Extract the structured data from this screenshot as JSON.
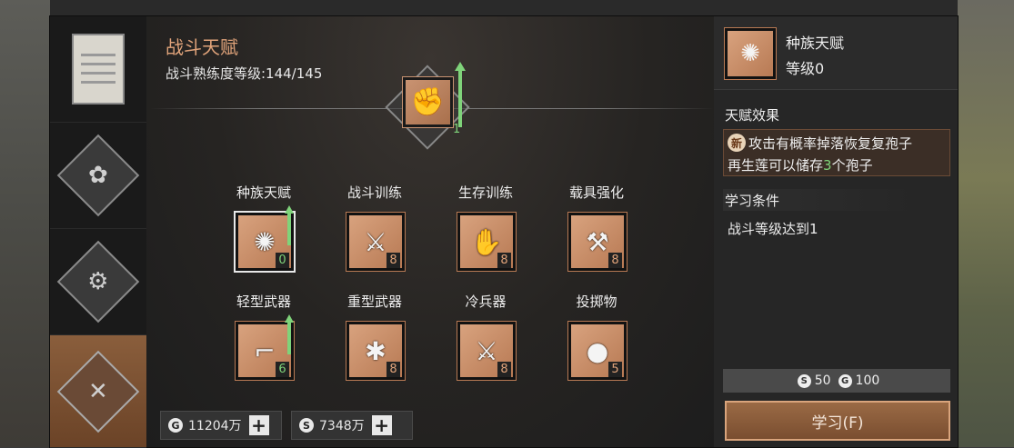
{
  "header": {
    "title": "战斗天赋",
    "proficiency": "战斗熟练度等级:144/145"
  },
  "hero": {
    "count": "1",
    "icon": "fist-upgrade-icon"
  },
  "skills": [
    {
      "label": "种族天赋",
      "level": "0",
      "icon": "spore-icon",
      "upgradable": true
    },
    {
      "label": "战斗训练",
      "level": "8",
      "icon": "crossed-blades-icon",
      "upgradable": false
    },
    {
      "label": "生存训练",
      "level": "8",
      "icon": "survival-icon",
      "upgradable": false
    },
    {
      "label": "载具强化",
      "level": "8",
      "icon": "vehicle-upgrade-icon",
      "upgradable": false
    },
    {
      "label": "轻型武器",
      "level": "6",
      "icon": "pistol-icon",
      "upgradable": true
    },
    {
      "label": "重型武器",
      "level": "8",
      "icon": "heavy-gun-icon",
      "upgradable": false
    },
    {
      "label": "冷兵器",
      "level": "8",
      "icon": "melee-icon",
      "upgradable": false
    },
    {
      "label": "投掷物",
      "level": "5",
      "icon": "grenade-icon",
      "upgradable": false
    }
  ],
  "currency": {
    "gold": "11204万",
    "silver": "7348万",
    "gold_symbol": "G",
    "silver_symbol": "S"
  },
  "detail": {
    "name": "种族天赋",
    "level": "等级0",
    "effect_header": "天赋效果",
    "new_badge": "新",
    "effect_line1": "攻击有概率掉落恢复复孢子",
    "effect_line2_pre": "再生莲可以储存",
    "effect_line2_num": "3",
    "effect_line2_post": "个孢子",
    "condition_header": "学习条件",
    "condition_text": "战斗等级达到1",
    "cost_silver": "50",
    "cost_gold": "100",
    "learn_button": "学习(F)"
  },
  "colors": {
    "accent": "#e0a37a",
    "green": "#7fd37a",
    "icon_bg": "#c98f6a"
  }
}
